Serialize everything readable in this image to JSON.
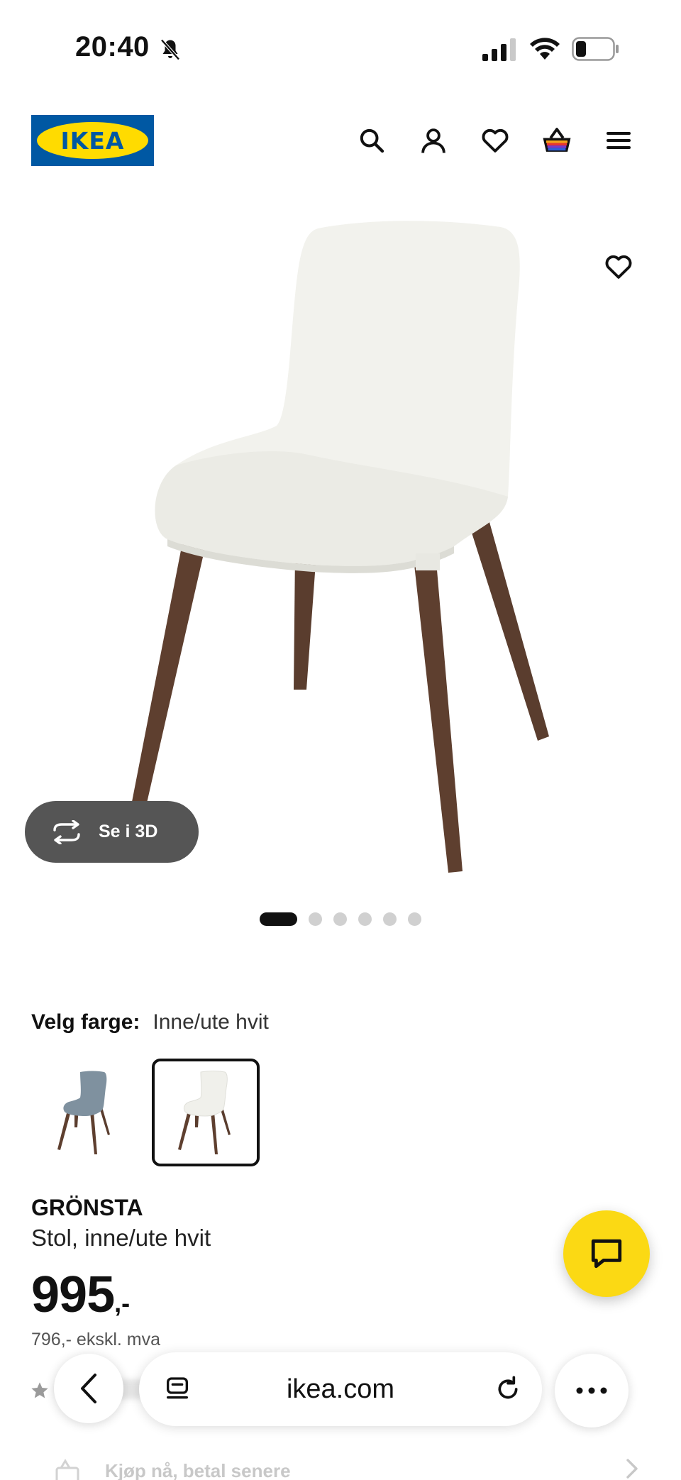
{
  "status_bar": {
    "time": "20:40",
    "icons": [
      "bell-muted-icon",
      "signal-icon",
      "wifi-icon",
      "battery-icon"
    ]
  },
  "header": {
    "logo_text": "IKEA",
    "brand_colors": {
      "blue": "#0058a3",
      "yellow": "#ffdb00"
    },
    "icons": [
      "search-icon",
      "account-icon",
      "heart-icon",
      "basket-icon",
      "menu-icon"
    ]
  },
  "gallery": {
    "view_3d_label": "Se i 3D",
    "image_count": 6,
    "active_index": 0
  },
  "color_select": {
    "label": "Velg farge:",
    "value": "Inne/ute hvit",
    "options": [
      {
        "name": "blue-grey",
        "color": "#7f919f",
        "selected": false
      },
      {
        "name": "white",
        "color": "#f3f3ef",
        "selected": true
      }
    ]
  },
  "product": {
    "name": "GRÖNSTA",
    "description": "Stol, inne/ute hvit",
    "price": "995",
    "price_suffix": ",-",
    "price_ex_vat": "796,- ekskl. mva"
  },
  "payment": {
    "label": "Kjøp nå, betal senere"
  },
  "browser": {
    "url": "ikea.com"
  },
  "colors": {
    "chat_button": "#fbd914",
    "view_3d_button": "#555555"
  }
}
